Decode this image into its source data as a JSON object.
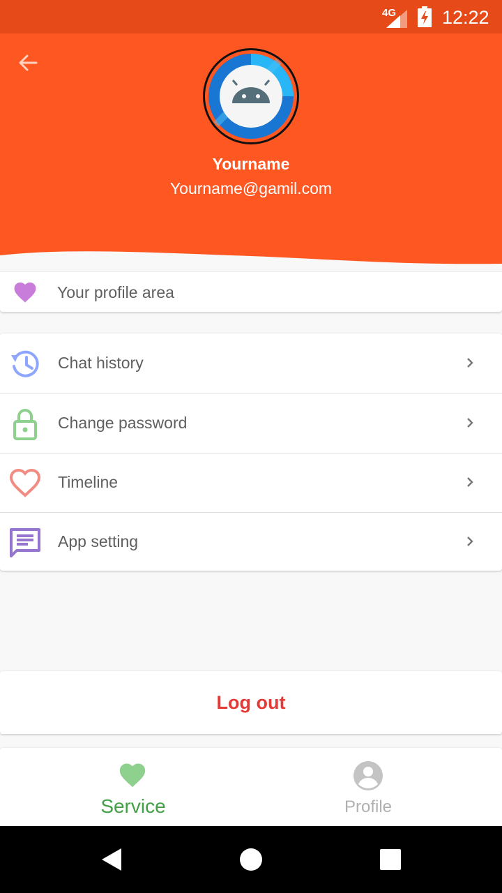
{
  "status_bar": {
    "network": "4G",
    "time": "12:22"
  },
  "header": {
    "user_name": "Yourname",
    "user_email": "Yourname@gamil.com",
    "bg_color": "#ff5722"
  },
  "profile_area": {
    "label": "Your profile area",
    "icon": "heart-icon",
    "icon_color": "#c77dd9"
  },
  "menu": {
    "items": [
      {
        "label": "Chat history",
        "icon": "history-icon",
        "icon_color": "#8fa6ff"
      },
      {
        "label": "Change password",
        "icon": "lock-icon",
        "icon_color": "#8ed18f"
      },
      {
        "label": "Timeline",
        "icon": "heart-outline-icon",
        "icon_color": "#f28b82"
      },
      {
        "label": "App setting",
        "icon": "message-icon",
        "icon_color": "#9575cd"
      }
    ]
  },
  "logout": {
    "label": "Log out",
    "color": "#e53935"
  },
  "bottom_nav": {
    "tabs": [
      {
        "label": "Service",
        "icon": "heart-icon",
        "active": true,
        "color": "#43a047"
      },
      {
        "label": "Profile",
        "icon": "account-circle-icon",
        "active": false,
        "color": "#b0b0b0"
      }
    ]
  }
}
